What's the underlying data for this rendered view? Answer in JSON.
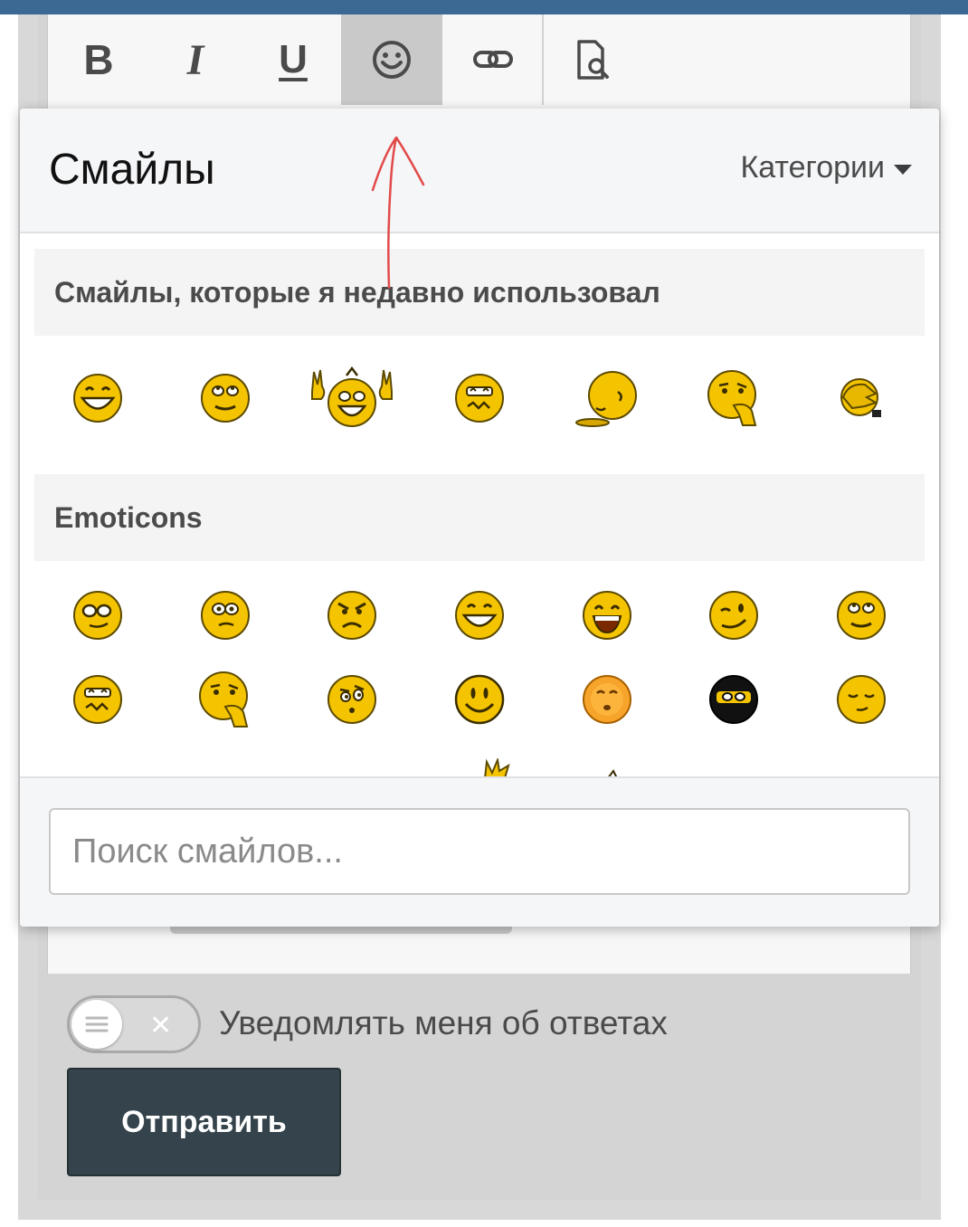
{
  "colors": {
    "top_bar": "#3c6894",
    "smile_yellow": "#f5c400",
    "annotation_red": "#e24a4a",
    "submit_bg": "#35444c"
  },
  "toolbar": {
    "bold_label": "B",
    "italic_label": "I",
    "underline_label": "U",
    "smilies_icon": "smiley-icon",
    "link_icon": "link-icon",
    "preview_icon": "preview-icon"
  },
  "smilies_panel": {
    "title": "Смайлы",
    "categories_label": "Категории",
    "recent_heading": "Смайлы, которые я недавно использовал",
    "recent": [
      "grin",
      "roll-eyes",
      "cheer",
      "confused",
      "sleepy",
      "thinking",
      "facepalm"
    ],
    "emoticons_heading": "Emoticons",
    "emoticons_row1": [
      "cool",
      "eek",
      "angry",
      "biggrin",
      "laugh",
      "wink",
      "roll-eyes"
    ],
    "emoticons_row2": [
      "confused",
      "thinking",
      "raised-eyebrow",
      "smile",
      "blush",
      "ninja",
      "sleep"
    ],
    "search_placeholder": "Поиск смайлов..."
  },
  "form": {
    "notify_label": "Уведомлять меня об ответах",
    "submit_label": "Отправить"
  }
}
